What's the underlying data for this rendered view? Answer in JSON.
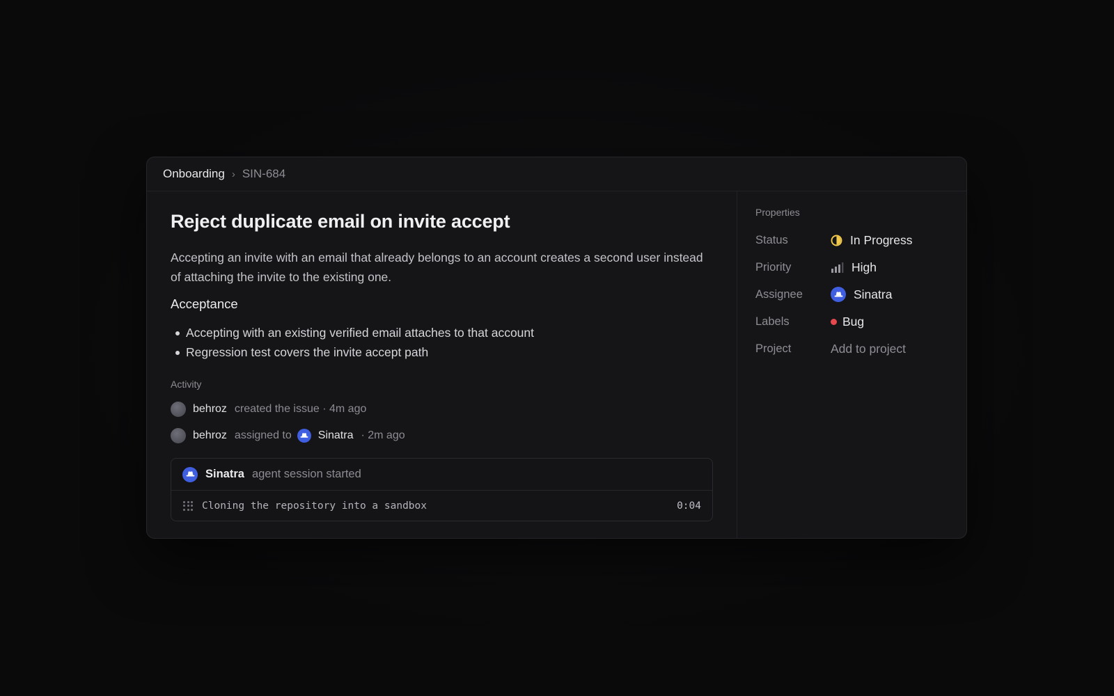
{
  "breadcrumb": {
    "parent": "Onboarding",
    "issue_id": "SIN-684"
  },
  "issue": {
    "title": "Reject duplicate email on invite accept",
    "description": "Accepting an invite with an email that already belongs to an account creates a second user instead of attaching the invite to the existing one.",
    "acceptance_heading": "Acceptance",
    "acceptance_items": [
      "Accepting with an existing verified email attaches to that account",
      "Regression test covers the invite accept path"
    ]
  },
  "activity": {
    "heading": "Activity",
    "events": [
      {
        "user": "behroz",
        "text": "created the issue · 4m ago"
      },
      {
        "user": "behroz",
        "text": "assigned to",
        "target": "Sinatra",
        "time": "· 2m ago"
      }
    ],
    "session": {
      "agent": "Sinatra",
      "status": "agent session started",
      "line": "Cloning the repository into a sandbox",
      "elapsed": "0:04"
    }
  },
  "properties": {
    "heading": "Properties",
    "status": {
      "key": "Status",
      "value": "In Progress",
      "color": "#f2c94c"
    },
    "priority": {
      "key": "Priority",
      "value": "High"
    },
    "assignee": {
      "key": "Assignee",
      "value": "Sinatra",
      "avatar_color": "#3f5ee0"
    },
    "labels": {
      "key": "Labels",
      "value": "Bug",
      "color": "#e5484d"
    },
    "project": {
      "key": "Project",
      "value": "Add to project"
    }
  }
}
